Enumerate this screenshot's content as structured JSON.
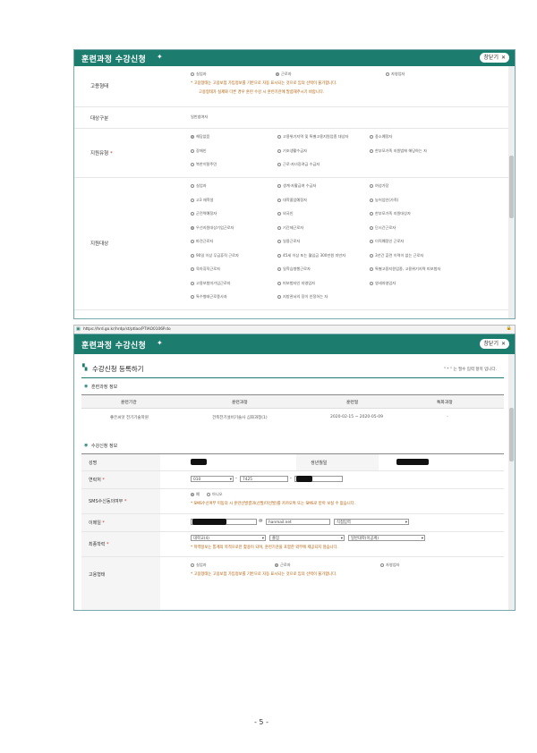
{
  "top_window": {
    "title": "훈련과정 수강신청",
    "close_label": "창닫기",
    "employment": {
      "label": "고용형태",
      "options": [
        "실업자",
        "근로자",
        "자영업자"
      ],
      "note1": "*  고용형태는 고용보험 가입정보를 기반으로 자동 표시되는 것으로 임의 선택이 불가합니다.",
      "note2": "고용형태가 실제와 다른 경우 훈련 수강 시 훈련기관에 말씀해주시기 바랍니다."
    },
    "target": {
      "label": "대상구분",
      "value": "일반참여자"
    },
    "support_type": {
      "label": "지원유형",
      "options": [
        "해당없음",
        "고용위기지역 및 특별고용지원업종 대상자",
        "중소예정자",
        "장애인",
        "기초생활수급자",
        "한부모가족 지원법에 해당하는 자",
        "북한이탈주민",
        "근로·자녀장려금 수급자"
      ]
    },
    "support_target": {
      "label": "지원대상",
      "options": [
        "실업자",
        "생계·자활급여 수급자",
        "여성가장",
        "고3 재학생",
        "대학졸업예정자",
        "농어업인(가족)",
        "군전역예정자",
        "외국인",
        "한부모가족 지원대상자",
        "우선지원대상기업근로자",
        "기간제근로자",
        "단시간근로자",
        "파견근로자",
        "일용근로자",
        "이직예정인 근로자",
        "90일 이상 무급휴직 근로자",
        "45세 이상 또는 월임금 300만원 미만자",
        "3년간 훈련 이력이 없는 근로자",
        "육아휴직근로자",
        "일학습병행근로자",
        "특별고용지원업종, 고용위기지역 피보험자",
        "고용보험미가입근로자",
        "피보험자인 자영업자",
        "영세자영업자",
        "특수형태근로종사자",
        "지방관서의 장이 인정하는 자"
      ]
    }
  },
  "url_bar": {
    "url": "https://hrd.go.kr/hrdp/st/ptlao/PTIAO0106P.do"
  },
  "bottom_window": {
    "title": "훈련과정 수강신청",
    "close_label": "창닫기",
    "heading": "수강신청 등록하기",
    "required_note": "\" * \" 는 필수 입력 항목 입니다.",
    "course_info": {
      "section": "훈련과정 정보",
      "headers": [
        "훈련기관",
        "훈련과정",
        "훈련일",
        "특화과정"
      ],
      "row": [
        "좋은씨앗 전기기술학원",
        "건축전기설비기술사 심화과정(1)",
        "2020-02-15 ~ 2020-05-09",
        "-"
      ]
    },
    "apply_info": {
      "section": "수강신청 정보",
      "name_label": "성명",
      "birth_label": "생년월일",
      "contact_label": "연락처",
      "phone1": "010",
      "phone2": "7425",
      "sms_label": "SMS수신동의여부",
      "sms_yes": "예",
      "sms_no": "아니오",
      "sms_note": "*  SMS수신여부 미동의 시 훈련선발결과(선발/미선발)를 카카오톡 또는 SMS로 받아 보실 수 없습니다.",
      "email_label": "이메일",
      "email_at": "@",
      "email_domain": "hanmail.net",
      "email_select": "직접입력",
      "edu_label": "최종학력",
      "edu1": "대학교(4)",
      "edu2": "졸업",
      "edu3": "일반대학(이공계)",
      "edu_note": "*  학력정보는 통계의 목적으로만 활용이 되며, 훈련기관을 포함한 외부에 제공되지 않습니다.",
      "emp_label": "고용형태",
      "emp_options": [
        "실업자",
        "근로자",
        "자영업자"
      ],
      "emp_note": "*  고용형태는 고용보험 가입정보를 기반으로 자동 표시되는 것으로 임의 선택이 불가합니다."
    }
  },
  "page_number": "- 5 -"
}
